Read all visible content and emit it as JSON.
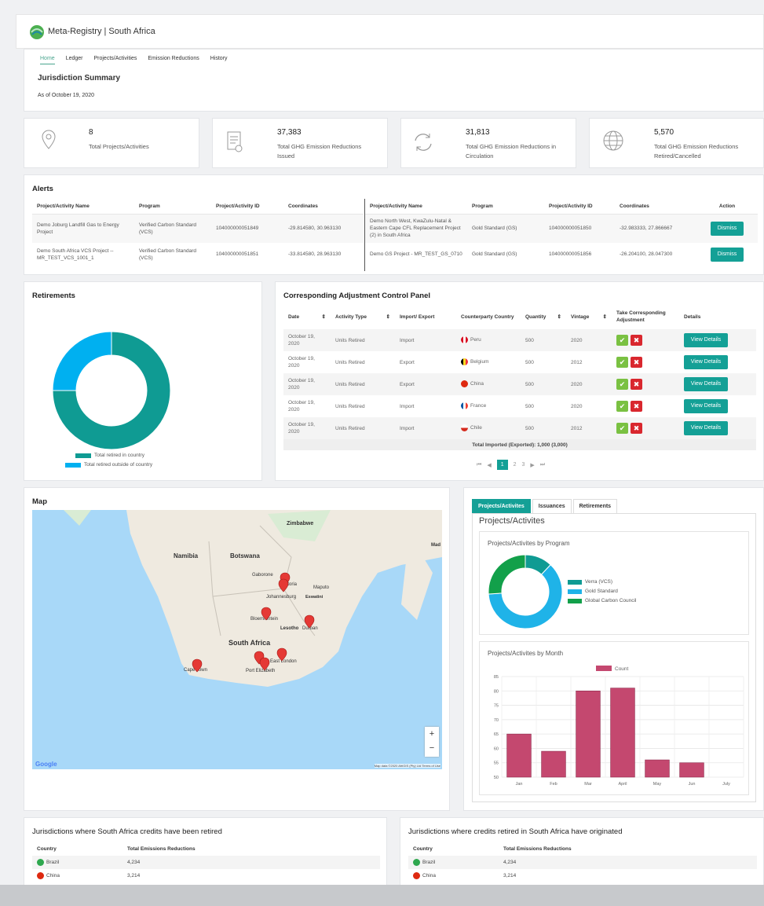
{
  "app": {
    "title": "Meta-Registry | South Africa"
  },
  "nav": {
    "tabs": [
      "Home",
      "Ledger",
      "Projects/Activities",
      "Emission Reductions",
      "History"
    ]
  },
  "summary": {
    "title": "Jurisdiction Summary",
    "date": "As of October 19, 2020"
  },
  "stats": [
    {
      "value": "8",
      "label": "Total Projects/Activities",
      "icon": "location-pin-icon"
    },
    {
      "value": "37,383",
      "label": "Total GHG Emission Reductions Issued",
      "icon": "document-icon"
    },
    {
      "value": "31,813",
      "label": "Total GHG Emission Reductions in Circulation",
      "icon": "refresh-icon"
    },
    {
      "value": "5,570",
      "label": "Total GHG Emission Reductions Retired/Cancelled",
      "icon": "globe-icon"
    }
  ],
  "alerts": {
    "title": "Alerts",
    "headers": [
      "Project/Activity Name",
      "Program",
      "Project/Activity ID",
      "Coordinates",
      "Project/Activity Name",
      "Program",
      "Project/Activity ID",
      "Coordinates",
      "Action"
    ],
    "rows": [
      [
        "Demo Joburg Landfill Gas to Energy Project",
        "Verified Carbon Standard (VCS)",
        "104000000051849",
        "-29.814580, 30.963130",
        "Demo North West, KwaZulu-Natal & Eastern Cape CFL Replacement Project (2) in South Africa",
        "Gold Standard (GS)",
        "104000000051850",
        "-32.983333, 27.866667",
        "Dismiss"
      ],
      [
        "Demo South Africa VCS Project -- MR_TEST_VCS_1001_1",
        "Verified Carbon Standard (VCS)",
        "104000000051851",
        "-33.814580, 28.963130",
        "Demo GS Project - MR_TEST_GS_0710",
        "Gold Standard (GS)",
        "104000000051856",
        "-26.204100, 28.047300",
        "Dismiss"
      ]
    ]
  },
  "retirements": {
    "title": "Retirements",
    "legend": [
      "Total retired in country",
      "Total retired outside of country"
    ],
    "colors": [
      "#0f9b93",
      "#00b0f0"
    ]
  },
  "cap": {
    "title": "Corresponding Adjustment Control Panel",
    "headers": [
      "Date",
      "Activity Type",
      "Import/ Export",
      "Counterparty Country",
      "Quantity",
      "Vintage",
      "Take Corresponding Adjustment",
      "Details"
    ],
    "rows": [
      {
        "date": "October 19, 2020",
        "type": "Units Retired",
        "ie": "Import",
        "country": "Peru",
        "qty": "500",
        "vintage": "2020",
        "details": "View Details"
      },
      {
        "date": "October 19, 2020",
        "type": "Units Retired",
        "ie": "Export",
        "country": "Belgium",
        "qty": "500",
        "vintage": "2012",
        "details": "View Details"
      },
      {
        "date": "October 19, 2020",
        "type": "Units Retired",
        "ie": "Export",
        "country": "China",
        "qty": "500",
        "vintage": "2020",
        "details": "View Details"
      },
      {
        "date": "October 19, 2020",
        "type": "Units Retired",
        "ie": "Import",
        "country": "France",
        "qty": "500",
        "vintage": "2020",
        "details": "View Details"
      },
      {
        "date": "October 19, 2020",
        "type": "Units Retired",
        "ie": "Import",
        "country": "Chile",
        "qty": "500",
        "vintage": "2012",
        "details": "View Details"
      }
    ],
    "total": "Total Imported (Exported): 1,000 (3,000)",
    "pages": [
      "1",
      "2",
      "3"
    ]
  },
  "map": {
    "title": "Map",
    "labels": [
      "Zimbabwe",
      "Namibia",
      "Botswana",
      "Gaborone",
      "Pretoria",
      "Maputo",
      "Johannesburg",
      "Eswatini",
      "Bloemfontein",
      "Lesotho",
      "Durban",
      "South Africa",
      "East London",
      "Cape Town",
      "Port Elizabeth",
      "Mad"
    ],
    "google": "Google",
    "attribution": "Map data ©2020 AfriGIS (Pty) Ltd  Terms of Use",
    "zoom_in": "+",
    "zoom_out": "−"
  },
  "projects": {
    "tabs": [
      "Projects/Activites",
      "Issuances",
      "Retirements"
    ],
    "heading": "Projects/Activites",
    "by_program_title": "Projects/Activites by Program",
    "by_month_title": "Projects/Activites by Month",
    "program_legend": [
      "Verra (VCS)",
      "Gold Standard",
      "Global Carbon Council"
    ],
    "program_colors": [
      "#0f9b93",
      "#1fb3e8",
      "#12a04a"
    ],
    "bar_color": "#c4486f"
  },
  "chart_data": [
    {
      "type": "pie",
      "title": "Retirements",
      "categories": [
        "Total retired in country",
        "Total retired outside of country"
      ],
      "values": [
        75,
        25
      ]
    },
    {
      "type": "pie",
      "title": "Projects/Activites by Program",
      "categories": [
        "Verra (VCS)",
        "Gold Standard",
        "Global Carbon Council"
      ],
      "values": [
        12,
        62,
        26
      ]
    },
    {
      "type": "bar",
      "title": "Projects/Activites by Month",
      "categories": [
        "Jan",
        "Feb",
        "Mar",
        "April",
        "May",
        "Jun",
        "July"
      ],
      "series": [
        {
          "name": "Count",
          "values": [
            65,
            59,
            80,
            81,
            56,
            55,
            0
          ]
        }
      ],
      "ylim": [
        50,
        85
      ],
      "yticks": [
        50,
        55,
        60,
        65,
        70,
        75,
        80,
        85
      ]
    }
  ],
  "jur_retired": {
    "title": "Jurisdictions where South Africa credits have been retired",
    "headers": [
      "Country",
      "Total Emissions Reductions"
    ],
    "rows": [
      [
        "Brazil",
        "4,234"
      ],
      [
        "China",
        "3,214"
      ]
    ]
  },
  "jur_origin": {
    "title": "Jurisdictions where credits retired in South Africa have originated",
    "headers": [
      "Country",
      "Total Emissions Reductions"
    ],
    "rows": [
      [
        "Brazil",
        "4,234"
      ],
      [
        "China",
        "3,214"
      ]
    ]
  }
}
